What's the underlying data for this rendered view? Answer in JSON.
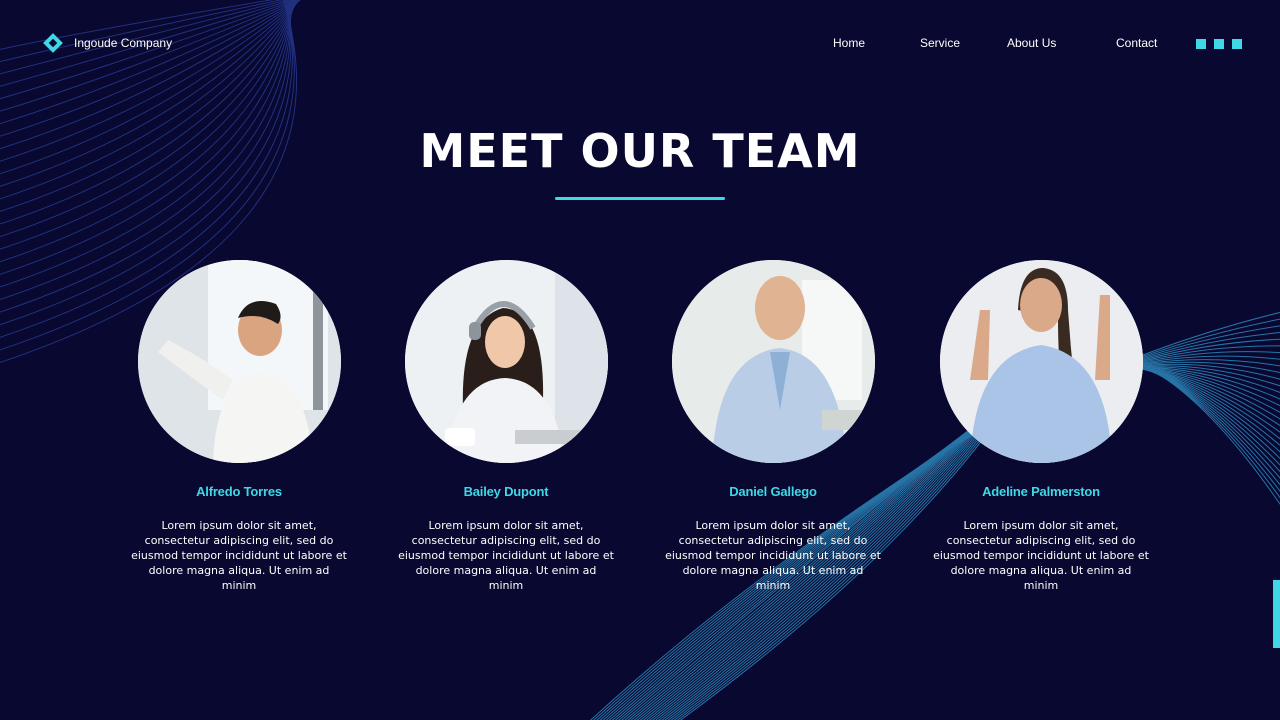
{
  "brand": {
    "name": "Ingoude Company"
  },
  "nav": {
    "items": [
      "Home",
      "Service",
      "About Us",
      "Contact"
    ]
  },
  "page": {
    "title": "MEET OUR TEAM"
  },
  "team": [
    {
      "name": "Alfredo Torres",
      "description": "Lorem ipsum dolor sit amet, consectetur adipiscing elit, sed do eiusmod tempor incididunt ut labore et dolore magna aliqua. Ut enim ad minim"
    },
    {
      "name": "Bailey Dupont",
      "description": "Lorem ipsum dolor sit amet, consectetur adipiscing elit, sed do eiusmod tempor incididunt ut labore et dolore magna aliqua. Ut enim ad minim"
    },
    {
      "name": "Daniel Gallego",
      "description": "Lorem ipsum dolor sit amet, consectetur adipiscing elit, sed do eiusmod tempor incididunt ut labore et dolore magna aliqua. Ut enim ad minim"
    },
    {
      "name": "Adeline Palmerston",
      "description": "Lorem ipsum dolor sit amet, consectetur adipiscing elit, sed do eiusmod tempor incididunt ut labore et dolore magna aliqua. Ut enim ad minim"
    }
  ],
  "colors": {
    "background": "#080830",
    "accent": "#3fd8e6",
    "text": "#ffffff"
  },
  "icons": {
    "logo": "diamond-logo-icon",
    "menu": "menu-dots-icon"
  }
}
